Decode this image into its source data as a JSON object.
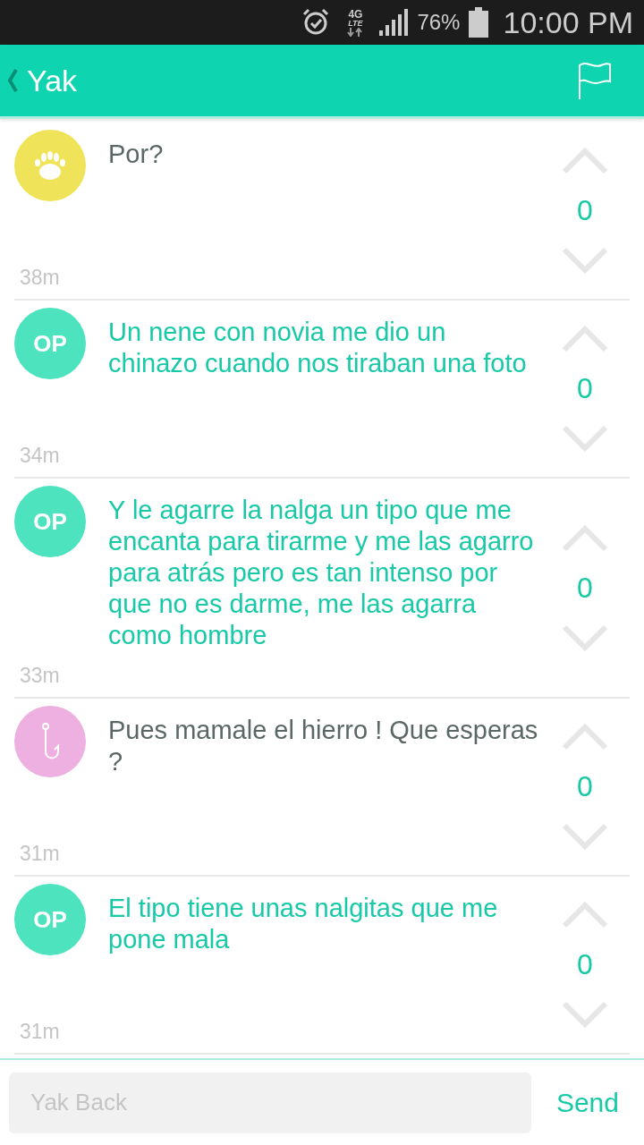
{
  "status_bar": {
    "network": "4G",
    "network_sub": "LTE",
    "battery": "76%",
    "time": "10:00 PM"
  },
  "header": {
    "title": "Yak"
  },
  "comments": [
    {
      "kind": "paw",
      "color": "#efe35a",
      "text": "Por?",
      "time": "38m",
      "score": "0"
    },
    {
      "kind": "op",
      "avatar_label": "OP",
      "color": "#4de3be",
      "text": "Un nene con novia me dio un chinazo cuando nos tiraban una foto",
      "time": "34m",
      "score": "0"
    },
    {
      "kind": "op",
      "avatar_label": "OP",
      "color": "#4de3be",
      "text": "Y le agarre la nalga un tipo que me encanta para tirarme y me las agarro para atrás pero es tan intenso por que no es darme, me las agarra como hombre",
      "time": "33m",
      "score": "0"
    },
    {
      "kind": "hook",
      "color": "#eeb0e0",
      "text": "Pues mamale el hierro ! Que esperas ?",
      "time": "31m",
      "score": "0"
    },
    {
      "kind": "op",
      "avatar_label": "OP",
      "color": "#4de3be",
      "text": "El tipo tiene unas nalgitas que me pone mala",
      "time": "31m",
      "score": "0"
    }
  ],
  "reply": {
    "placeholder": "Yak Back",
    "send": "Send"
  }
}
